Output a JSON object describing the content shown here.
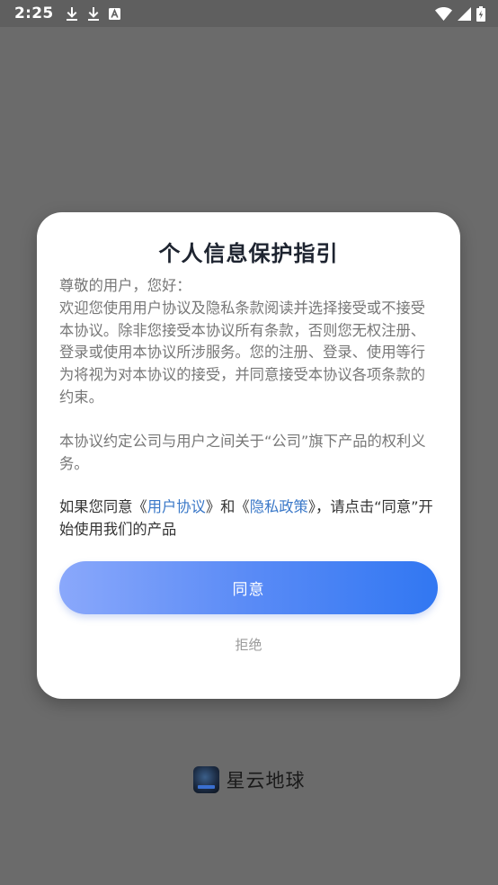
{
  "status_bar": {
    "time": "2:25",
    "left_icons": [
      "download-icon",
      "download-icon",
      "font-a-icon"
    ],
    "right_icons": [
      "wifi-icon",
      "signal-icon",
      "battery-icon"
    ]
  },
  "dialog": {
    "title": "个人信息保护指引",
    "greeting": "尊敬的用户，您好：",
    "paragraph1": "欢迎您使用用户协议及隐私条款阅读并选择接受或不接受本协议。除非您接受本协议所有条款，否则您无权注册、登录或使用本协议所涉服务。您的注册、登录、使用等行为将视为对本协议的接受，并同意接受本协议各项条款的约束。",
    "paragraph2": "本协议约定公司与用户之间关于“公司”旗下产品的权利义务。",
    "consent": {
      "prefix": "如果您同意《",
      "user_agreement_link": "用户协议",
      "middle": "》和《",
      "privacy_policy_link": "隐私政策",
      "suffix": "》，请点击“同意”开始使用我们的产品"
    },
    "agree_label": "同意",
    "reject_label": "拒绝"
  },
  "brand": {
    "app_name": "星云地球",
    "logo_icon": "earth-logo-icon"
  },
  "colors": {
    "backdrop": "#6b6b6b",
    "link": "#3a78c8",
    "button_gradient_start": "#8aa8fb",
    "button_gradient_end": "#3177f2"
  }
}
